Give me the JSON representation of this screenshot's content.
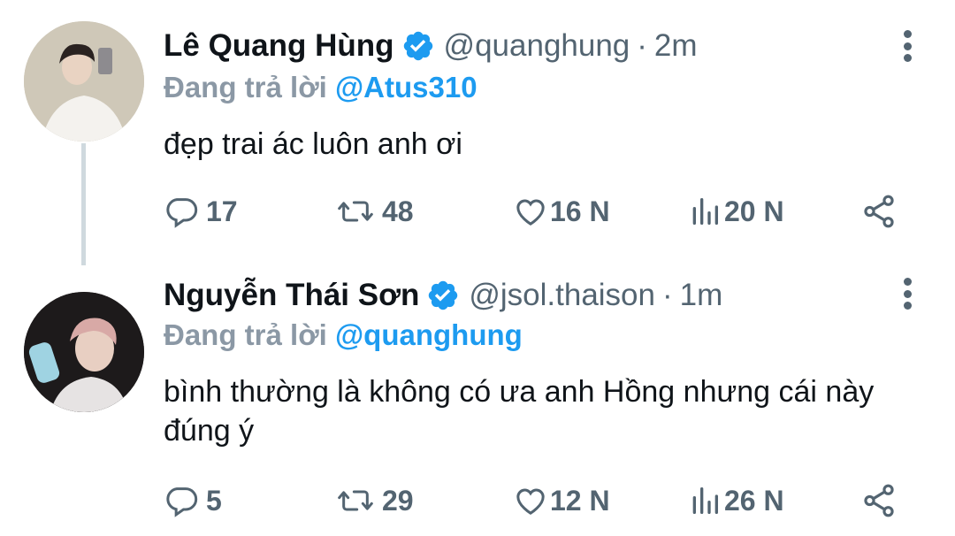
{
  "tweets": [
    {
      "name": "Lê Quang Hùng",
      "handle": "@quanghung",
      "separator": "·",
      "time": "2m",
      "replying_label": "Đang trả lời",
      "replying_to": "@Atus310",
      "text": "đẹp trai ác luôn anh ơi",
      "replies": "17",
      "retweets": "48",
      "likes": "16 N",
      "views": "20 N",
      "icons": [
        "reply-icon",
        "retweet-icon",
        "like-icon",
        "views-icon",
        "share-icon"
      ]
    },
    {
      "name": "Nguyễn Thái Sơn",
      "handle": "@jsol.thaison",
      "separator": "·",
      "time": "1m",
      "replying_label": "Đang trả lời",
      "replying_to": "@quanghung",
      "text": "bình thường là không có ưa anh Hồng nhưng cái này đúng ý",
      "replies": "5",
      "retweets": "29",
      "likes": "12 N",
      "views": "26 N",
      "icons": [
        "reply-icon",
        "retweet-icon",
        "like-icon",
        "views-icon",
        "share-icon"
      ]
    }
  ],
  "colors": {
    "verified": "#1d9bf0",
    "mention": "#1d9bf0",
    "muted": "#536471",
    "text": "#0f1419",
    "thread_line": "#cfd9de"
  }
}
